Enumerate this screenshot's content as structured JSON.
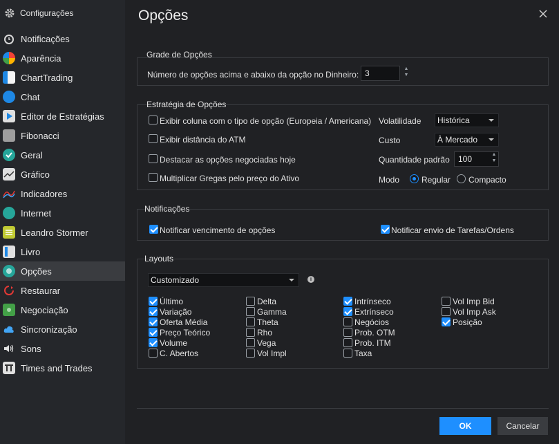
{
  "sidebar": {
    "header": "Configurações",
    "items": [
      {
        "label": "Notificações",
        "icon": "alarm-clock-icon"
      },
      {
        "label": "Aparência",
        "icon": "color-wheel-icon"
      },
      {
        "label": "ChartTrading",
        "icon": "chart-trading-icon"
      },
      {
        "label": "Chat",
        "icon": "chat-icon"
      },
      {
        "label": "Editor de Estratégias",
        "icon": "play-icon"
      },
      {
        "label": "Fibonacci",
        "icon": "calculator-icon"
      },
      {
        "label": "Geral",
        "icon": "check-circle-icon"
      },
      {
        "label": "Gráfico",
        "icon": "line-chart-icon"
      },
      {
        "label": "Indicadores",
        "icon": "indicator-wave-icon"
      },
      {
        "label": "Internet",
        "icon": "globe-icon"
      },
      {
        "label": "Leandro Stormer",
        "icon": "list-icon"
      },
      {
        "label": "Livro",
        "icon": "book-icon"
      },
      {
        "label": "Opções",
        "icon": "options-circle-icon"
      },
      {
        "label": "Restaurar",
        "icon": "restore-icon"
      },
      {
        "label": "Negociação",
        "icon": "money-icon"
      },
      {
        "label": "Sincronização",
        "icon": "cloud-icon"
      },
      {
        "label": "Sons",
        "icon": "speaker-icon"
      },
      {
        "label": "Times and Trades",
        "icon": "tt-icon"
      }
    ],
    "active_index": 12
  },
  "dialog": {
    "title": "Opções",
    "close_icon": "close-icon"
  },
  "grade": {
    "title": "Grade de Opções",
    "label": "Número de opções acima e abaixo da opção no Dinheiro:",
    "value": "3"
  },
  "estrategia": {
    "title": "Estratégia de Opções",
    "checkboxes": [
      {
        "label": "Exibir coluna com o tipo de opção (Europeia / Americana)",
        "checked": false
      },
      {
        "label": "Exibir distância do ATM",
        "checked": false
      },
      {
        "label": "Destacar as opções negociadas hoje",
        "checked": false
      },
      {
        "label": "Multiplicar Gregas pelo preço do Ativo",
        "checked": false
      }
    ],
    "volatilidade_label": "Volatilidade",
    "volatilidade_value": "Histórica",
    "custo_label": "Custo",
    "custo_value": "À Mercado",
    "quantidade_label": "Quantidade padrão",
    "quantidade_value": "100",
    "modo_label": "Modo",
    "modo_options": [
      "Regular",
      "Compacto"
    ],
    "modo_selected": "Regular"
  },
  "notificacoes": {
    "title": "Notificações",
    "vencimento_label": "Notificar vencimento de opções",
    "vencimento_checked": true,
    "envio_label": "Notificar envio de Tarefas/Ordens",
    "envio_checked": true
  },
  "layouts": {
    "title": "Layouts",
    "selected": "Customizado",
    "info_icon": "info-icon",
    "columns": [
      [
        {
          "label": "Último",
          "checked": true
        },
        {
          "label": "Variação",
          "checked": true
        },
        {
          "label": "Oferta Média",
          "checked": true
        },
        {
          "label": "Preço Teórico",
          "checked": true
        },
        {
          "label": "Volume",
          "checked": true
        },
        {
          "label": "C. Abertos",
          "checked": false
        }
      ],
      [
        {
          "label": "Delta",
          "checked": false
        },
        {
          "label": "Gamma",
          "checked": false
        },
        {
          "label": "Theta",
          "checked": false
        },
        {
          "label": "Rho",
          "checked": false
        },
        {
          "label": "Vega",
          "checked": false
        },
        {
          "label": "Vol Impl",
          "checked": false
        }
      ],
      [
        {
          "label": "Intrínseco",
          "checked": true
        },
        {
          "label": "Extrínseco",
          "checked": true
        },
        {
          "label": "Negócios",
          "checked": false
        },
        {
          "label": "Prob. OTM",
          "checked": false
        },
        {
          "label": "Prob. ITM",
          "checked": false
        },
        {
          "label": "Taxa",
          "checked": false
        }
      ],
      [
        {
          "label": "Vol Imp Bid",
          "checked": false
        },
        {
          "label": "Vol Imp Ask",
          "checked": false
        },
        {
          "label": "Posição",
          "checked": true
        }
      ]
    ]
  },
  "buttons": {
    "ok": "OK",
    "cancel": "Cancelar"
  },
  "colors": {
    "accent": "#1e8fff",
    "background": "#202124",
    "sidebar": "#25272b",
    "active_item": "#3a3c40"
  }
}
